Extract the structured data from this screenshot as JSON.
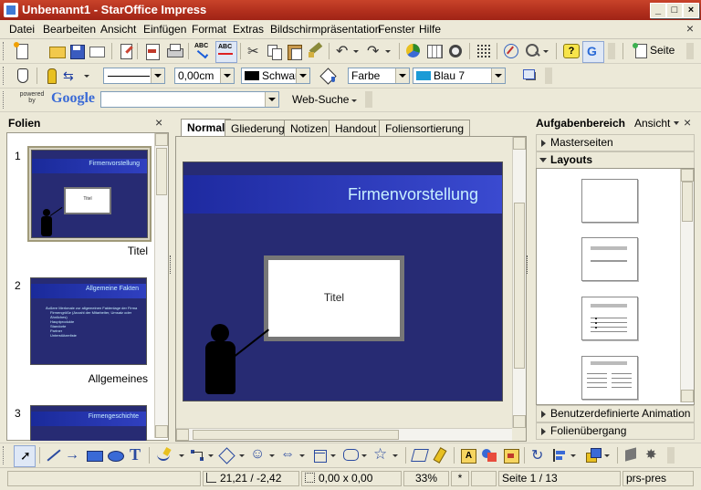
{
  "window": {
    "title": "Unbenannt1 - StarOffice Impress"
  },
  "menu": [
    "Datei",
    "Bearbeiten",
    "Ansicht",
    "Einfügen",
    "Format",
    "Extras",
    "Bildschirmpräsentation",
    "Fenster",
    "Hilfe"
  ],
  "toolbar": {
    "seite_label": "Seite"
  },
  "line_toolbar": {
    "line_width": "0,00cm",
    "color_name": "Schwarz",
    "area_style": "Farbe",
    "area_color": "Blau 7"
  },
  "search_toolbar": {
    "powered_by": "powered by",
    "google": "Google",
    "search_query": "",
    "websuche_label": "Web-Suche"
  },
  "slides_panel": {
    "title": "Folien",
    "slides": [
      {
        "number": "1",
        "heading": "Firmenvorstellung",
        "box_text": "Titel",
        "caption": "Titel"
      },
      {
        "number": "2",
        "heading": "Allgemeine Fakten",
        "caption": "Allgemeines",
        "bullets": [
          "Äußere Merkmale zur allgemeinen Faktenlage der Firma",
          "Firmengröße (Anzahl der Mitarbeiter, Umsatz oder Ähnliches)",
          "Hauptprodukte",
          "Standorte",
          "Partner",
          "Unterstützerliste"
        ]
      },
      {
        "number": "3",
        "heading": "Firmengeschichte"
      }
    ]
  },
  "view_tabs": [
    "Normal",
    "Gliederung",
    "Notizen",
    "Handout",
    "Foliensortierung"
  ],
  "active_tab": "Normal",
  "main_slide": {
    "title": "Firmenvorstellung",
    "box_text": "Titel"
  },
  "task_pane": {
    "title": "Aufgabenbereich",
    "view_label": "Ansicht",
    "sections": {
      "masterpages": "Masterseiten",
      "layouts": "Layouts",
      "custom_animation": "Benutzerdefinierte Animation",
      "slide_transition": "Folienübergang"
    }
  },
  "statusbar": {
    "position": "21,21 / -2,42",
    "size": "0,00 x 0,00",
    "zoom": "33%",
    "modified": "*",
    "page": "Seite 1 / 13",
    "layout_name": "prs-pres"
  },
  "colors": {
    "slide_bg": "#272b73",
    "slide_header": "#2a3bb8",
    "slide_title": "#c8f0ff",
    "title_bar": "#b02e1c",
    "chrome": "#ece9d8"
  }
}
